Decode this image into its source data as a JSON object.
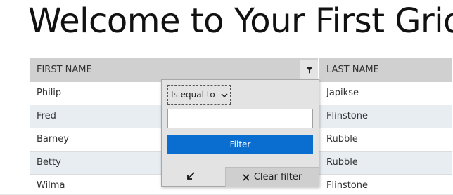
{
  "page": {
    "title": "Welcome to Your First Grid"
  },
  "grid": {
    "columns": [
      {
        "label": "FIRST NAME"
      },
      {
        "label": "LAST NAME"
      }
    ],
    "rows": [
      {
        "first": "Philip",
        "last": "Japikse"
      },
      {
        "first": "Fred",
        "last": "Flinstone"
      },
      {
        "first": "Barney",
        "last": "Rubble"
      },
      {
        "first": "Betty",
        "last": "Rubble"
      },
      {
        "first": "Wilma",
        "last": "Flinstone"
      }
    ]
  },
  "filter": {
    "operator": "Is equal to",
    "value": "",
    "apply_label": "Filter",
    "clear_label": "Clear filter"
  },
  "icons": {
    "header_filter": "filter-funnel-icon",
    "operator_dropdown": "chevron-down-icon",
    "collapse": "arrow-down-left-icon",
    "clear": "close-icon"
  },
  "colors": {
    "header_bg": "#d0d0d0",
    "alt_row_bg": "#e7edf1",
    "accent": "#0a6ed1",
    "panel_bg": "#e3e3e3"
  }
}
